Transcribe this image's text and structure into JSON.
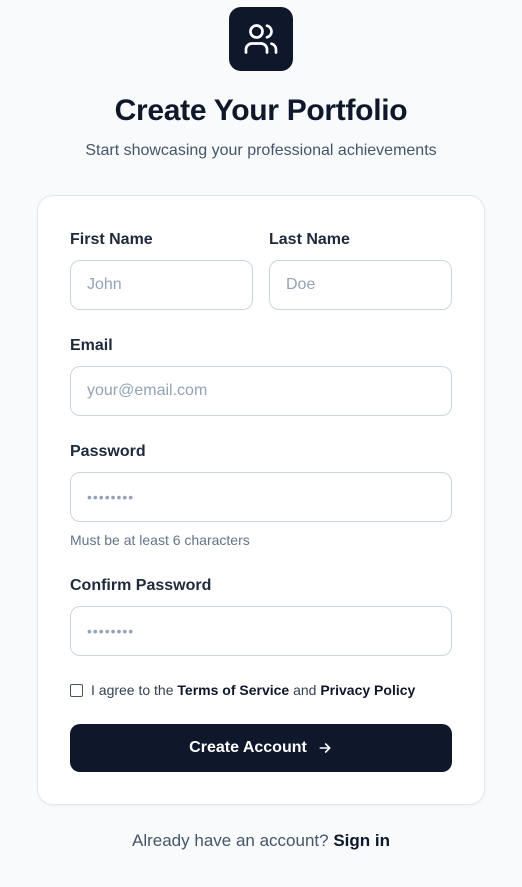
{
  "header": {
    "logo_icon": "users-icon",
    "title": "Create Your Portfolio",
    "subtitle": "Start showcasing your professional achievements"
  },
  "form": {
    "first_name": {
      "label": "First Name",
      "placeholder": "John"
    },
    "last_name": {
      "label": "Last Name",
      "placeholder": "Doe"
    },
    "email": {
      "label": "Email",
      "placeholder": "your@email.com"
    },
    "password": {
      "label": "Password",
      "placeholder": "••••••••",
      "hint": "Must be at least 6 characters"
    },
    "confirm_password": {
      "label": "Confirm Password",
      "placeholder": "••••••••"
    },
    "terms": {
      "prefix": "I agree to the ",
      "terms_link": "Terms of Service",
      "middle": " and ",
      "privacy_link": "Privacy Policy",
      "checked": false
    },
    "submit_label": "Create Account",
    "submit_icon": "arrow-right-icon"
  },
  "footer": {
    "prompt": "Already have an account? ",
    "link": "Sign in"
  },
  "colors": {
    "background": "#f8fafc",
    "primary": "#0f172a",
    "border": "#cbd5e1",
    "placeholder": "#94a3b8"
  }
}
